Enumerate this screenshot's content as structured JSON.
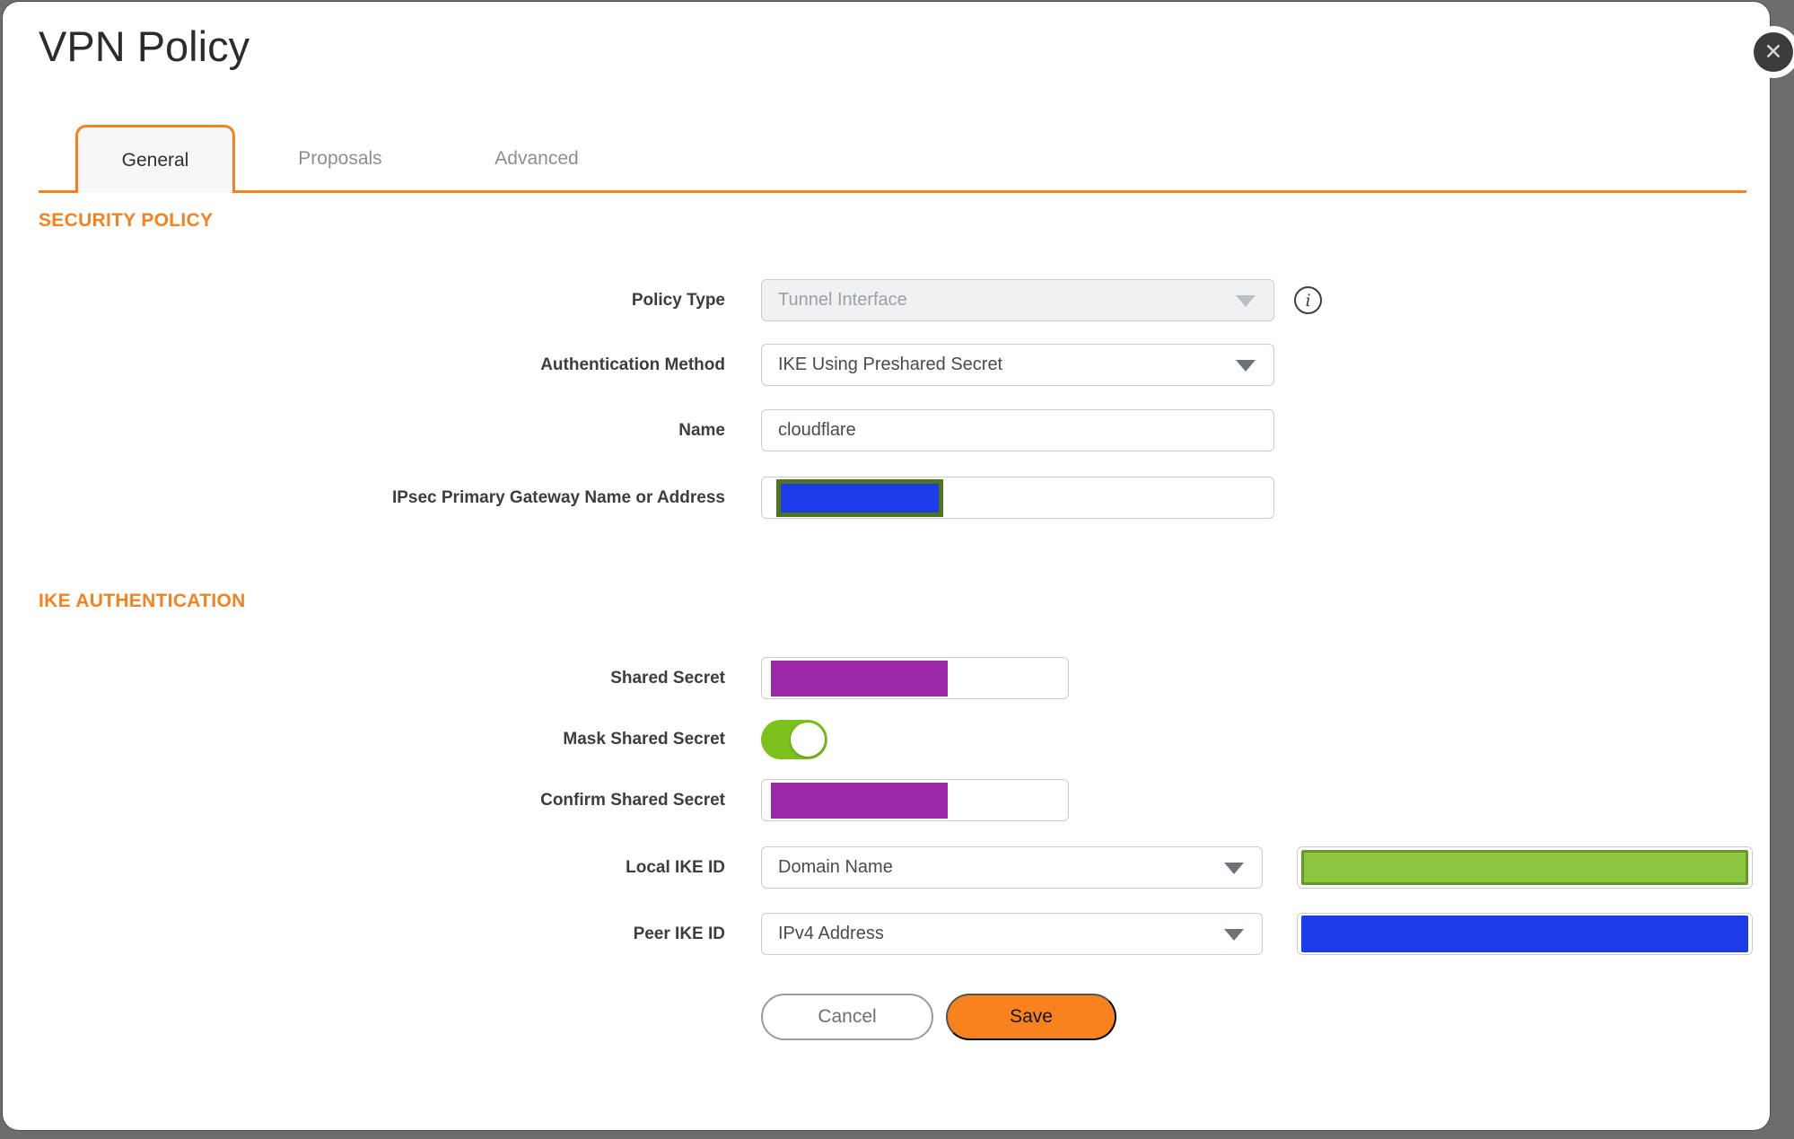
{
  "dialog": {
    "title": "VPN Policy"
  },
  "icons": {
    "close": "✕",
    "info": "i"
  },
  "tabs": {
    "general": {
      "label": "General",
      "active": true
    },
    "proposals": {
      "label": "Proposals",
      "active": false
    },
    "advanced": {
      "label": "Advanced",
      "active": false
    }
  },
  "security_policy": {
    "heading": "SECURITY POLICY",
    "policy_type": {
      "label": "Policy Type",
      "value": "Tunnel Interface",
      "disabled": true
    },
    "auth_method": {
      "label": "Authentication Method",
      "value": "IKE Using Preshared Secret"
    },
    "name": {
      "label": "Name",
      "value": "cloudflare"
    },
    "gateway": {
      "label": "IPsec Primary Gateway Name or Address",
      "value_state": "redacted"
    }
  },
  "ike_authentication": {
    "heading": "IKE AUTHENTICATION",
    "shared_secret": {
      "label": "Shared Secret",
      "value_state": "redacted-masked"
    },
    "mask_shared_secret": {
      "label": "Mask Shared Secret",
      "state": "on"
    },
    "confirm_shared_secret": {
      "label": "Confirm Shared Secret",
      "value_state": "redacted-masked"
    },
    "local_ike_id": {
      "label": "Local IKE ID",
      "value": "Domain Name",
      "id_value_state": "redacted"
    },
    "peer_ike_id": {
      "label": "Peer IKE ID",
      "value": "IPv4 Address",
      "id_value_state": "redacted"
    }
  },
  "actions": {
    "cancel": "Cancel",
    "save": "Save"
  },
  "colors": {
    "accent_orange": "#f5821f",
    "save_button": "#f8821d",
    "toggle_on_green": "#7cc11d",
    "redaction_blue": "#1e3be9",
    "redaction_purple": "#9d28a8",
    "redaction_green_fill": "#8dc63f",
    "redaction_green_border": "#66982c",
    "redaction_olive_border": "#4e751d",
    "backdrop_gray": "#6d6d6d"
  }
}
